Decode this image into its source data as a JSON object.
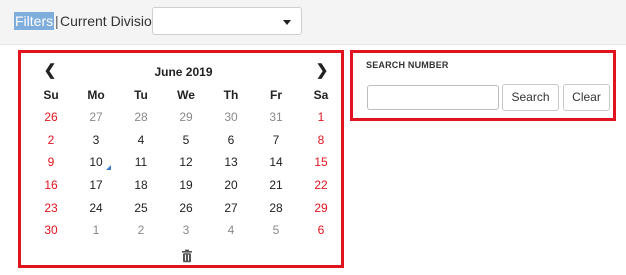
{
  "filter_bar": {
    "filters_label": "Filters",
    "separator": "|",
    "division_label": "Current Division:",
    "division_value": ""
  },
  "calendar": {
    "month_title": "June 2019",
    "prev_icon": "chevron-left-icon",
    "next_icon": "chevron-right-icon",
    "weekdays": [
      "Su",
      "Mo",
      "Tu",
      "We",
      "Th",
      "Fr",
      "Sa"
    ],
    "weeks": [
      [
        {
          "d": "26",
          "o": true
        },
        {
          "d": "27",
          "o": true
        },
        {
          "d": "28",
          "o": true
        },
        {
          "d": "29",
          "o": true
        },
        {
          "d": "30",
          "o": true
        },
        {
          "d": "31",
          "o": true
        },
        {
          "d": "1",
          "o": false
        }
      ],
      [
        {
          "d": "2",
          "o": false
        },
        {
          "d": "3",
          "o": false
        },
        {
          "d": "4",
          "o": false
        },
        {
          "d": "5",
          "o": false
        },
        {
          "d": "6",
          "o": false
        },
        {
          "d": "7",
          "o": false
        },
        {
          "d": "8",
          "o": false
        }
      ],
      [
        {
          "d": "9",
          "o": false
        },
        {
          "d": "10",
          "o": false,
          "today": true
        },
        {
          "d": "11",
          "o": false
        },
        {
          "d": "12",
          "o": false
        },
        {
          "d": "13",
          "o": false
        },
        {
          "d": "14",
          "o": false
        },
        {
          "d": "15",
          "o": false
        }
      ],
      [
        {
          "d": "16",
          "o": false
        },
        {
          "d": "17",
          "o": false
        },
        {
          "d": "18",
          "o": false
        },
        {
          "d": "19",
          "o": false
        },
        {
          "d": "20",
          "o": false
        },
        {
          "d": "21",
          "o": false
        },
        {
          "d": "22",
          "o": false
        }
      ],
      [
        {
          "d": "23",
          "o": false
        },
        {
          "d": "24",
          "o": false
        },
        {
          "d": "25",
          "o": false
        },
        {
          "d": "26",
          "o": false
        },
        {
          "d": "27",
          "o": false
        },
        {
          "d": "28",
          "o": false
        },
        {
          "d": "29",
          "o": false
        }
      ],
      [
        {
          "d": "30",
          "o": false
        },
        {
          "d": "1",
          "o": true
        },
        {
          "d": "2",
          "o": true
        },
        {
          "d": "3",
          "o": true
        },
        {
          "d": "4",
          "o": true
        },
        {
          "d": "5",
          "o": true
        },
        {
          "d": "6",
          "o": true
        }
      ]
    ],
    "clear_icon": "trash-icon"
  },
  "search": {
    "title": "SEARCH NUMBER",
    "input_value": "",
    "search_label": "Search",
    "clear_label": "Clear"
  },
  "colors": {
    "highlight_border": "#e0141e",
    "weekend_text": "#e0141e",
    "selected_filter_bg": "#7faedc",
    "today_marker": "#3d7cc9"
  }
}
